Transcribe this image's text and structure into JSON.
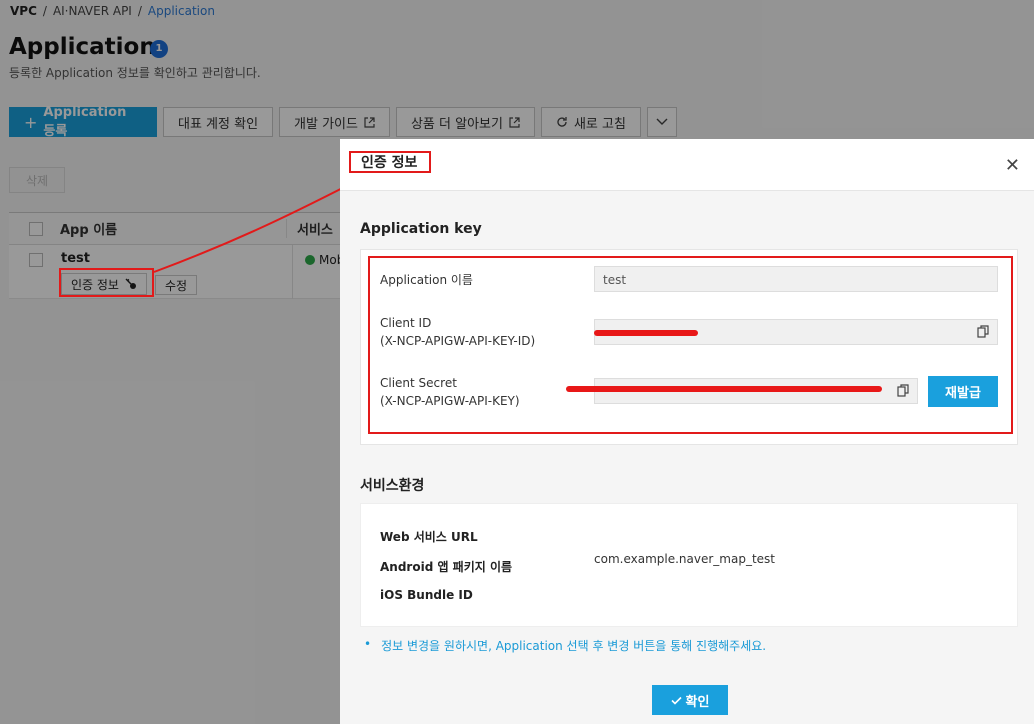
{
  "breadcrumb": {
    "root": "VPC",
    "sep1": "/",
    "parent": "AI·NAVER API",
    "sep2": "/",
    "current": "Application"
  },
  "page": {
    "title": "Application",
    "count": "1",
    "description": "등록한 Application 정보를 확인하고 관리합니다."
  },
  "toolbar": {
    "register": "Application 등록",
    "account": "대표 계정 확인",
    "guide": "개발 가이드",
    "more": "상품 더 알아보기",
    "refresh": "새로 고침"
  },
  "table": {
    "delete_label": "삭제",
    "header_name": "App 이름",
    "header_service": "서비스",
    "rows": [
      {
        "name": "test",
        "auth_label": "인증 정보",
        "edit_label": "수정",
        "service": "Mob"
      }
    ]
  },
  "modal": {
    "title": "인증 정보",
    "key_section": "Application key",
    "app_name_label": "Application 이름",
    "app_name_value": "test",
    "client_id_label": "Client ID",
    "client_id_sub": "(X-NCP-APIGW-API-KEY-ID)",
    "client_secret_label": "Client Secret",
    "client_secret_sub": "(X-NCP-APIGW-API-KEY)",
    "regen_label": "재발급",
    "env_section": "서비스환경",
    "web_url_label": "Web 서비스 URL",
    "android_label": "Android 앱 패키지 이름",
    "android_value": "com.example.naver_map_test",
    "ios_label": "iOS Bundle ID",
    "notice": "정보 변경을 원하시면, Application 선택 후 변경 버튼을 통해 진행해주세요.",
    "ok_label": "확인"
  },
  "colors": {
    "accent": "#1aa0dd",
    "annotation": "#e21a1a",
    "badge": "#1e6fd9"
  }
}
